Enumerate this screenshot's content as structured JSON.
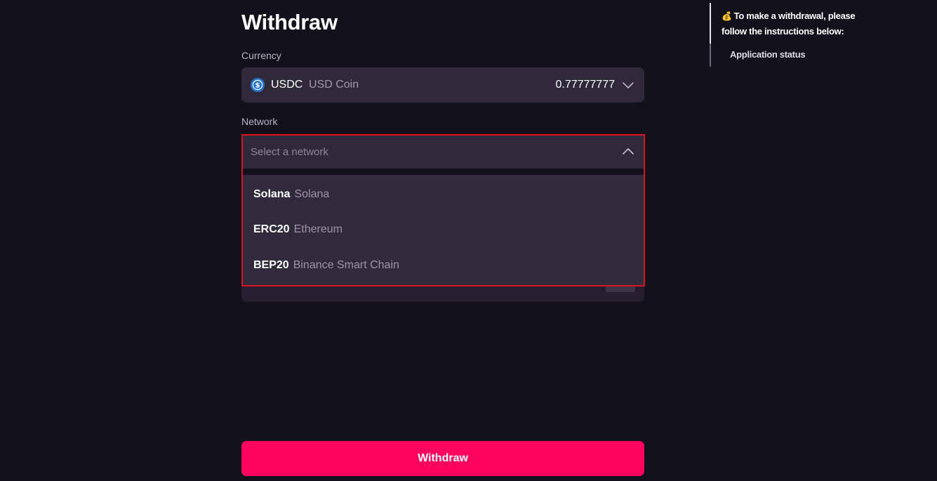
{
  "page": {
    "title": "Withdraw"
  },
  "currency": {
    "label": "Currency",
    "code": "USDC",
    "name": "USD Coin",
    "balance": "0.77777777",
    "icon": "usdc-coin-icon"
  },
  "network": {
    "label": "Network",
    "placeholder": "Select a network",
    "options": [
      {
        "code": "Solana",
        "name": "Solana"
      },
      {
        "code": "ERC20",
        "name": "Ethereum"
      },
      {
        "code": "BEP20",
        "name": "Binance Smart Chain"
      }
    ]
  },
  "actions": {
    "withdraw_label": "Withdraw"
  },
  "sidebar": {
    "icon": "money-bag-icon",
    "instructions": "To make a withdrawal, please follow the instructions below:",
    "status_label": "Application status"
  },
  "colors": {
    "background": "#13111b",
    "field": "#2e2a3b",
    "accent": "#ff055e",
    "highlight_border": "#e0121f"
  }
}
